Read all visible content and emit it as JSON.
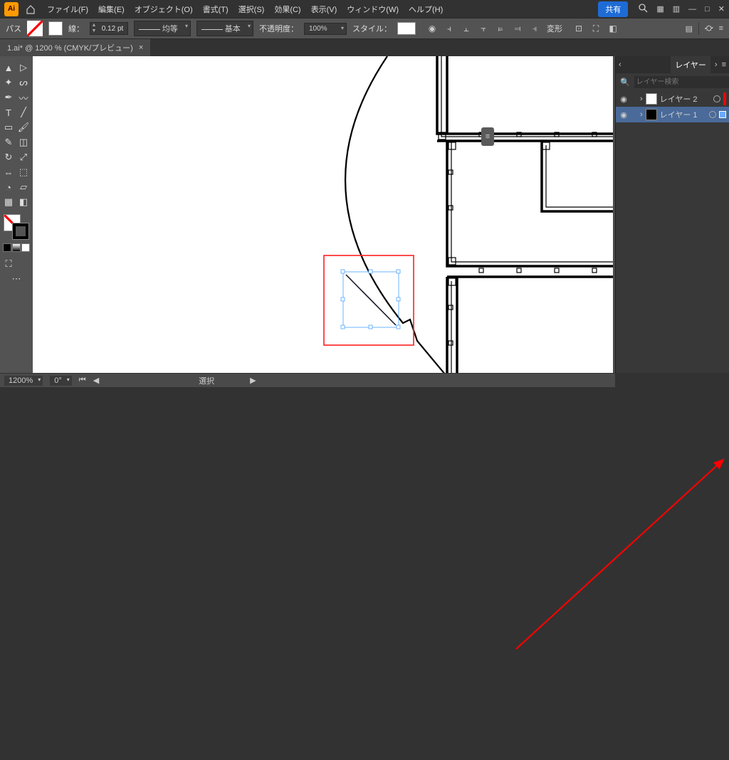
{
  "app": {
    "logo": "Ai"
  },
  "menu": {
    "file": "ファイル(F)",
    "edit": "編集(E)",
    "object": "オブジェクト(O)",
    "type": "書式(T)",
    "select": "選択(S)",
    "effect": "効果(C)",
    "view": "表示(V)",
    "window": "ウィンドウ(W)",
    "help": "ヘルプ(H)"
  },
  "share": "共有",
  "control": {
    "sel_type": "パス",
    "stroke_label": "線：",
    "stroke_w": "0.12 pt",
    "uniform": "均等",
    "basic": "基本",
    "opacity_label": "不透明度：",
    "opacity": "100%",
    "style_label": "スタイル：",
    "transform": "変形"
  },
  "doc": {
    "tab": "1.ai* @ 1200 % (CMYK/プレビュー)",
    "close": "×"
  },
  "layers_panel": {
    "title": "レイヤー",
    "search_ph": "レイヤー検索",
    "items": [
      {
        "name": "レイヤー 2",
        "color": "#ff0000",
        "selected": false,
        "thumb": "white"
      },
      {
        "name": "レイヤー 1",
        "color": "#5ec0ff",
        "selected": true,
        "thumb": "black"
      }
    ]
  },
  "status": {
    "zoom": "1200%",
    "rotate": "0°",
    "mode": "選択"
  }
}
